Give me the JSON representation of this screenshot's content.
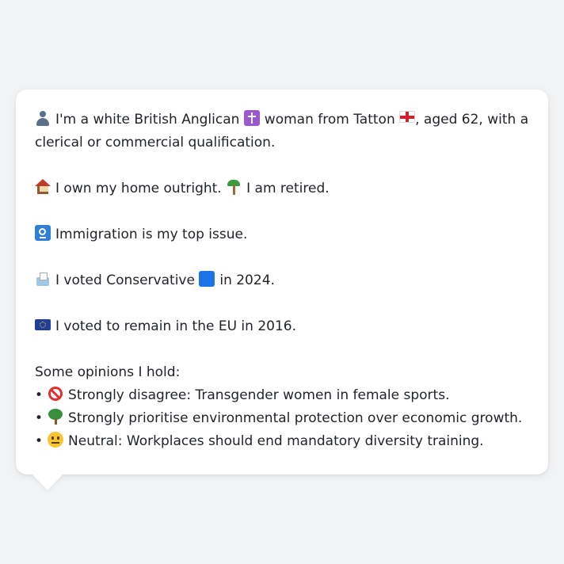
{
  "persona": {
    "intro": {
      "icon": "person-silhouette-icon",
      "text_before": "I'm a white British Anglican",
      "religion_icon": "latin-cross-icon",
      "text_middle": "woman from Tatton",
      "location_icon": "england-flag-icon",
      "text_after": ", aged 62, with a clerical or commercial qualification."
    },
    "housing": {
      "icon": "house-icon",
      "text": "I own my home outright.",
      "work_icon": "palm-tree-icon",
      "work_text": "I am retired."
    },
    "top_issue": {
      "icon": "passport-control-icon",
      "text": "Immigration is my top issue."
    },
    "vote_2024": {
      "icon": "ballot-box-icon",
      "text_before": "I voted Conservative",
      "party_icon": "blue-square-icon",
      "text_after": "in 2024."
    },
    "brexit": {
      "icon": "eu-flag-icon",
      "text": "I voted to remain in the EU in 2016."
    },
    "opinions_heading": "Some opinions I hold:",
    "opinions": [
      {
        "bullet": "•",
        "icon": "no-entry-icon",
        "text": "Strongly disagree: Transgender women in female sports."
      },
      {
        "bullet": "•",
        "icon": "deciduous-tree-icon",
        "text": "Strongly prioritise environmental protection over economic growth."
      },
      {
        "bullet": "•",
        "icon": "neutral-face-icon",
        "text": "Neutral: Workplaces should end mandatory diversity training."
      }
    ]
  },
  "colors": {
    "background": "#f1f3f5",
    "bubble": "#ffffff",
    "text": "#1f2328"
  }
}
